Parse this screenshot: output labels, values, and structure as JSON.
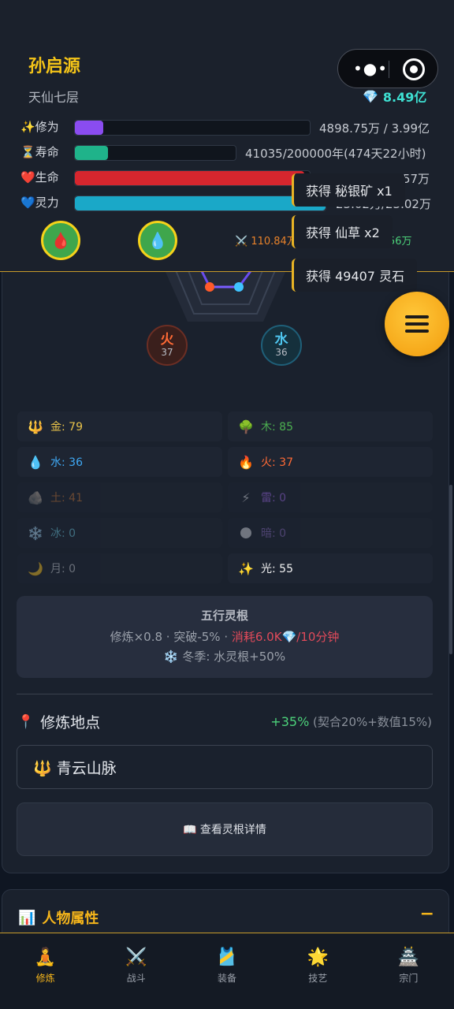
{
  "header": {
    "player_name": "孙启源",
    "realm": "天仙七层",
    "gems": "8.49亿",
    "stats": [
      {
        "icon": "✨",
        "label": "修为",
        "value": "4898.75万 / 3.99亿",
        "fraction": 0.12,
        "color": "#8a4cf0"
      },
      {
        "icon": "⏳",
        "label": "寿命",
        "value": "41035/200000年(474天22小时)",
        "fraction": 0.205,
        "color": "#1fb38a"
      },
      {
        "icon": "❤️",
        "label": "生命",
        "value": "358.20万/366.57万",
        "fraction": 0.977,
        "color": "#d6262e"
      },
      {
        "icon": "💙",
        "label": "灵力",
        "value": "23.02万/23.02万",
        "fraction": 1.0,
        "color": "#1aa8c8"
      }
    ],
    "attack": "110.84万",
    "defense": "22.56万"
  },
  "toasts": [
    "获得 秘银矿 x1",
    "获得 仙草 x2",
    "获得 49407 灵石"
  ],
  "elements_visual": {
    "fire": {
      "glyph": "火",
      "value": "37"
    },
    "water": {
      "glyph": "水",
      "value": "36"
    }
  },
  "spirit_roots": [
    {
      "icon": "🔱",
      "label": "金: 79",
      "color": "#e8c24a",
      "dim": false
    },
    {
      "icon": "🌳",
      "label": "木: 85",
      "color": "#4caf50",
      "dim": false
    },
    {
      "icon": "💧",
      "label": "水: 36",
      "color": "#3fa9f5",
      "dim": false
    },
    {
      "icon": "🔥",
      "label": "火: 37",
      "color": "#ff6a35",
      "dim": false
    },
    {
      "icon": "🪨",
      "label": "土: 41",
      "color": "#c9793a",
      "dim": true
    },
    {
      "icon": "⚡",
      "label": "雷: 0",
      "color": "#a56cf0",
      "dim": true
    },
    {
      "icon": "❄️",
      "label": "冰: 0",
      "color": "#6cc7e0",
      "dim": true
    },
    {
      "icon": "🌑",
      "label": "暗: 0",
      "color": "#8a6cc0",
      "dim": true
    },
    {
      "icon": "🌙",
      "label": "月: 0",
      "color": "#c8ccd4",
      "dim": true
    },
    {
      "icon": "✨",
      "label": "光: 55",
      "color": "#f1f1f1",
      "dim": false
    }
  ],
  "wuxing": {
    "title": "五行灵根",
    "line1_prefix": "修炼×0.8 · 突破-5% · ",
    "line1_cost": "消耗6.0K💎/10分钟",
    "line2": "❄️ 冬季: 水灵根+50%"
  },
  "location": {
    "title": "修炼地点",
    "bonus_pct": "+35%",
    "bonus_detail": "(契合20%+数值15%)",
    "current": "🔱 青云山脉",
    "detail_button": "📖 查看灵根详情"
  },
  "attributes": {
    "title": "人物属性",
    "collapse": "−"
  },
  "nav": [
    {
      "icon": "🧘",
      "label": "修炼",
      "active": true
    },
    {
      "icon": "⚔️",
      "label": "战斗",
      "active": false
    },
    {
      "icon": "🎽",
      "label": "装备",
      "active": false
    },
    {
      "icon": "🌟",
      "label": "技艺",
      "active": false
    },
    {
      "icon": "🏯",
      "label": "宗门",
      "active": false
    }
  ]
}
